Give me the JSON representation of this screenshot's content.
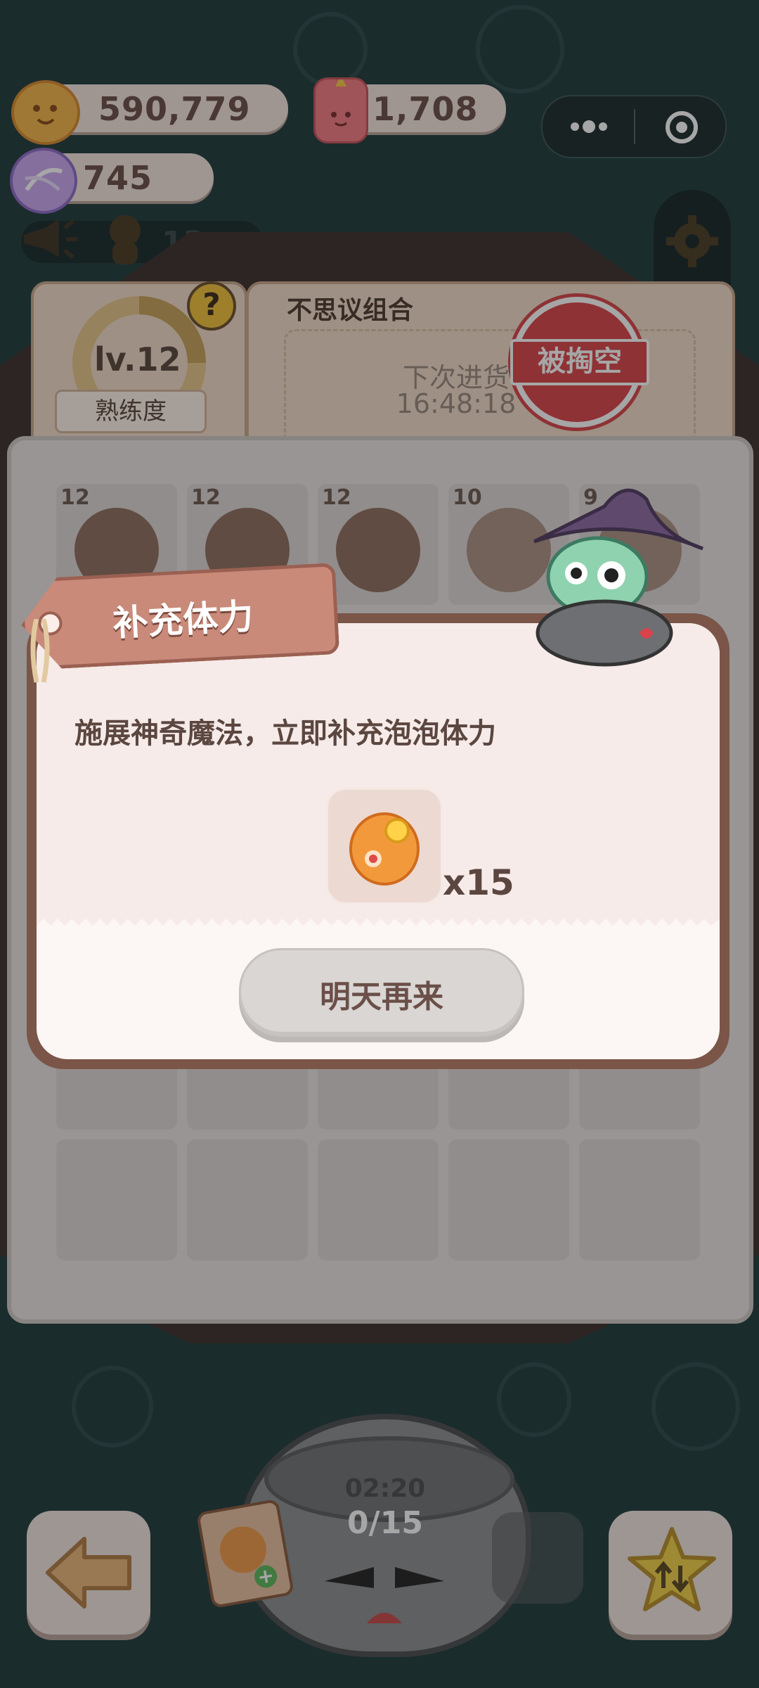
{
  "currencies": {
    "coins": {
      "value": "590,779",
      "icon": "cookie-coin-icon"
    },
    "energy": {
      "value": "1,708",
      "icon": "red-candle-icon"
    },
    "gems": {
      "value": "745",
      "icon": "purple-candy-icon"
    }
  },
  "announcement": {
    "count": "13"
  },
  "level_panel": {
    "level": "lv.12",
    "proficiency_label": "熟练度"
  },
  "shop_panel": {
    "title": "不思议组合",
    "next_restock_label": "下次进货",
    "next_restock_time": "16:48:18",
    "stamp": "被掏空"
  },
  "board": {
    "row1_levels": [
      "12",
      "12",
      "12",
      "10",
      "9"
    ]
  },
  "dialog": {
    "title": "补充体力",
    "description": "施展神奇魔法，立即补充泡泡体力",
    "reward_quantity": "x15",
    "button_label": "明天再来"
  },
  "pot": {
    "timer": "02:20",
    "progress": "0/15"
  },
  "colors": {
    "background": "#1f3b3d",
    "dialog_border": "#7a5548",
    "title_tag": "#c98a7a",
    "text_brown": "#6b4f48"
  }
}
